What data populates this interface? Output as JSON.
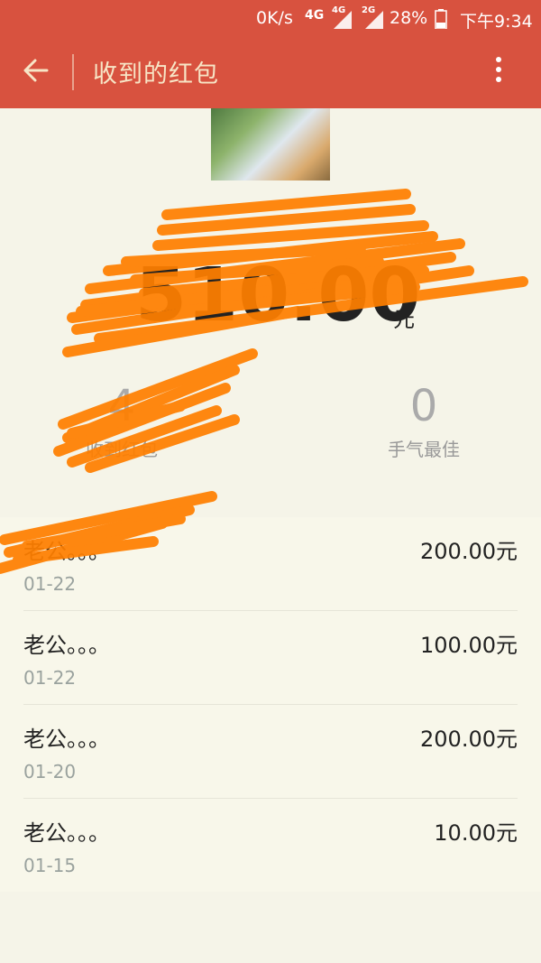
{
  "status_bar": {
    "speed": "0K/s",
    "net1": "4G",
    "net2": "4G",
    "net3": "2G",
    "battery": "28%",
    "time": "下午9:34"
  },
  "app_bar": {
    "title": "收到的红包"
  },
  "summary": {
    "total_amount": "510.00",
    "total_unit": "元",
    "received_count": "4",
    "received_label": "收到红包",
    "best_count": "0",
    "best_label": "手气最佳"
  },
  "records": [
    {
      "name": "老公。。。",
      "date": "01-22",
      "amount": "200.00元"
    },
    {
      "name": "老公。。。",
      "date": "01-22",
      "amount": "100.00元"
    },
    {
      "name": "老公。。。",
      "date": "01-20",
      "amount": "200.00元"
    },
    {
      "name": "老公。。。",
      "date": "01-15",
      "amount": "10.00元"
    }
  ],
  "colors": {
    "app_bar": "#d8523f",
    "title_text": "#f7e5c6",
    "background": "#f5f4e8",
    "redaction": "#ff7f00"
  }
}
